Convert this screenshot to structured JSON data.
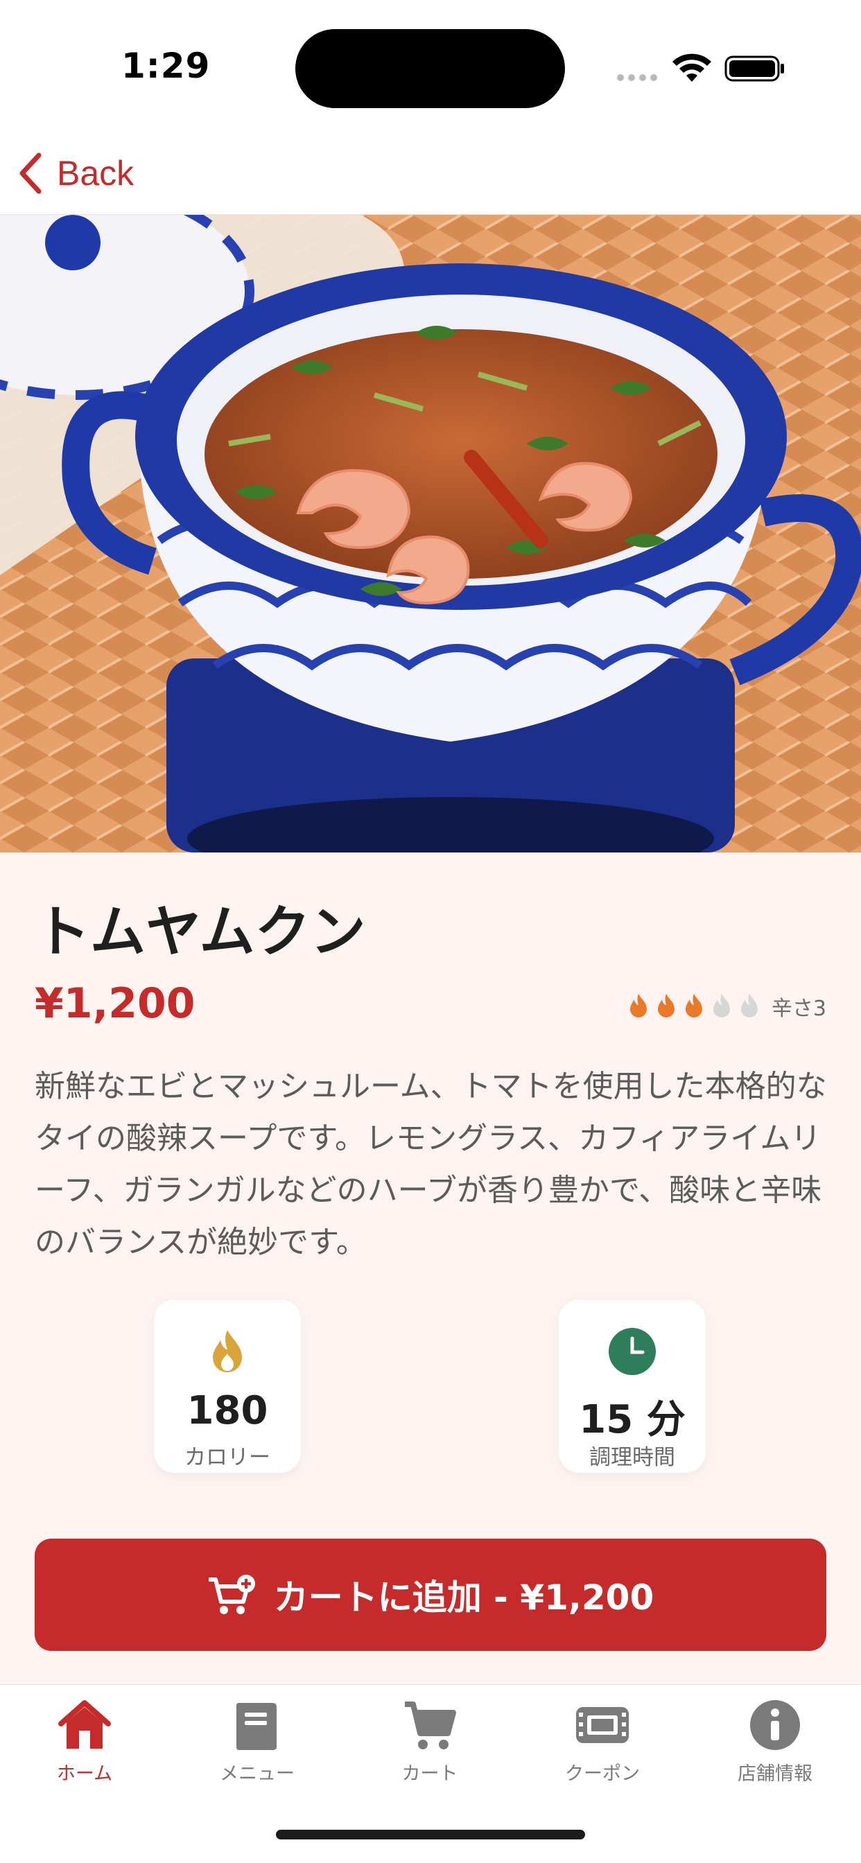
{
  "status_bar": {
    "time": "1:29"
  },
  "nav": {
    "back_label": "Back"
  },
  "dish": {
    "title": "トムヤムクン",
    "price": "¥1,200",
    "spice_level": 3,
    "spice_max": 5,
    "spice_label": "辛さ3",
    "description": "新鮮なエビとマッシュルーム、トマトを使用した本格的なタイの酸辣スープです。レモングラス、カフィアライムリーフ、ガランガルなどのハーブが香り豊かで、酸味と辛味のバランスが絶妙です。"
  },
  "stats": {
    "calories": {
      "value": "180",
      "label": "カロリー",
      "icon": "flame-icon"
    },
    "cook_time": {
      "value": "15 分",
      "label": "調理時間",
      "icon": "clock-icon"
    }
  },
  "add_to_cart": {
    "label": "カートに追加 - ¥1,200",
    "icon": "cart-plus-icon"
  },
  "tabs": [
    {
      "label": "ホーム",
      "icon": "home-icon",
      "active": true
    },
    {
      "label": "メニュー",
      "icon": "menu-book-icon",
      "active": false
    },
    {
      "label": "カート",
      "icon": "cart-icon",
      "active": false
    },
    {
      "label": "クーポン",
      "icon": "coupon-ticket-icon",
      "active": false
    },
    {
      "label": "店舗情報",
      "icon": "info-icon",
      "active": false
    }
  ],
  "colors": {
    "accent": "#c52b2b",
    "spice_active": "#e8792a",
    "spice_inactive": "#d6d6d6",
    "calorie_icon": "#d9a53a",
    "clock_icon": "#2e7d5b",
    "content_bg": "#fdf4f1"
  }
}
